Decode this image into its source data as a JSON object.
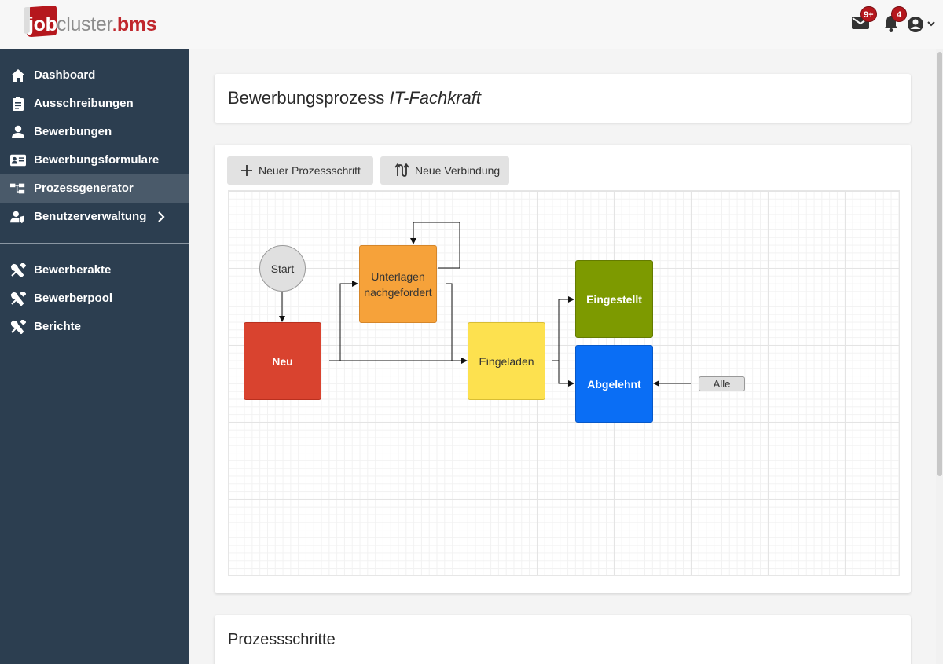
{
  "brand": {
    "prefix": "job",
    "name": "cluster",
    "dot": ".",
    "suffix": "bms"
  },
  "header": {
    "mail_badge": "9+",
    "bell_badge": "4"
  },
  "sidebar": {
    "items": [
      {
        "label": "Dashboard",
        "icon": "home-icon"
      },
      {
        "label": "Ausschreibungen",
        "icon": "clipboard-icon"
      },
      {
        "label": "Bewerbungen",
        "icon": "user-icon"
      },
      {
        "label": "Bewerbungsformulare",
        "icon": "id-card-icon"
      },
      {
        "label": "Prozessgenerator",
        "icon": "sitemap-icon",
        "active": true
      },
      {
        "label": "Benutzerverwaltung",
        "icon": "user-shield-icon"
      }
    ],
    "tools": [
      {
        "label": "Bewerberakte",
        "icon": "tools-icon"
      },
      {
        "label": "Bewerberpool",
        "icon": "tools-icon"
      },
      {
        "label": "Berichte",
        "icon": "tools-icon"
      }
    ]
  },
  "page": {
    "title_prefix": "Bewerbungsprozess",
    "title_name": "IT-Fachkraft",
    "section_title": "Prozessschritte"
  },
  "toolbar": {
    "new_step": "Neuer Prozessschritt",
    "new_connection": "Neue Verbindung"
  },
  "diagram": {
    "nodes": {
      "start": {
        "label": "Start",
        "color": "#e0e0e0"
      },
      "neu": {
        "label": "Neu",
        "color": "#d9432f"
      },
      "unterlagen": {
        "label_line1": "Unterlagen",
        "label_line2": "nachgefordert",
        "color": "#f6a23a"
      },
      "eingeladen": {
        "label": "Eingeladen",
        "color": "#fde14f"
      },
      "eingestellt": {
        "label": "Eingestellt",
        "color": "#7d9a00"
      },
      "abgelehnt": {
        "label": "Abgelehnt",
        "color": "#0a6ef5"
      },
      "alle": {
        "label": "Alle",
        "color": "#e0e0e0"
      }
    }
  }
}
